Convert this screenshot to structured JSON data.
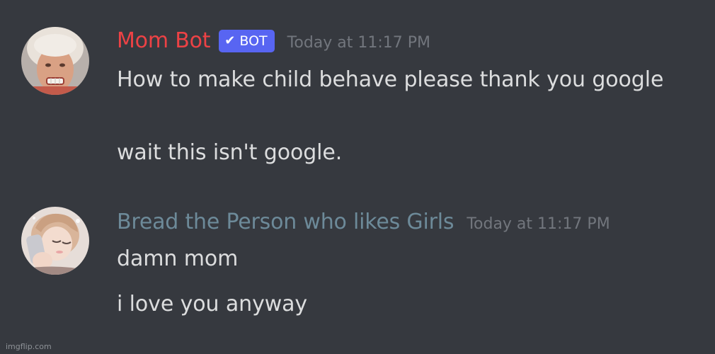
{
  "messages": [
    {
      "username": "Mom Bot",
      "username_color": "#ed4245",
      "badge": {
        "check": "✔",
        "label": "BOT",
        "color": "#5865f2"
      },
      "timestamp": "Today at 11:17 PM",
      "lines": [
        "How to make child behave please thank you google",
        "wait this isn't google."
      ]
    },
    {
      "username": "Bread the Person who likes Girls",
      "username_color": "#6d8a99",
      "timestamp": "Today at 11:17 PM",
      "lines": [
        "damn mom",
        "i love you anyway"
      ]
    }
  ],
  "watermark": "imgflip.com",
  "colors": {
    "background": "#36393f",
    "message_text": "#dcddde",
    "timestamp": "#72767d"
  }
}
